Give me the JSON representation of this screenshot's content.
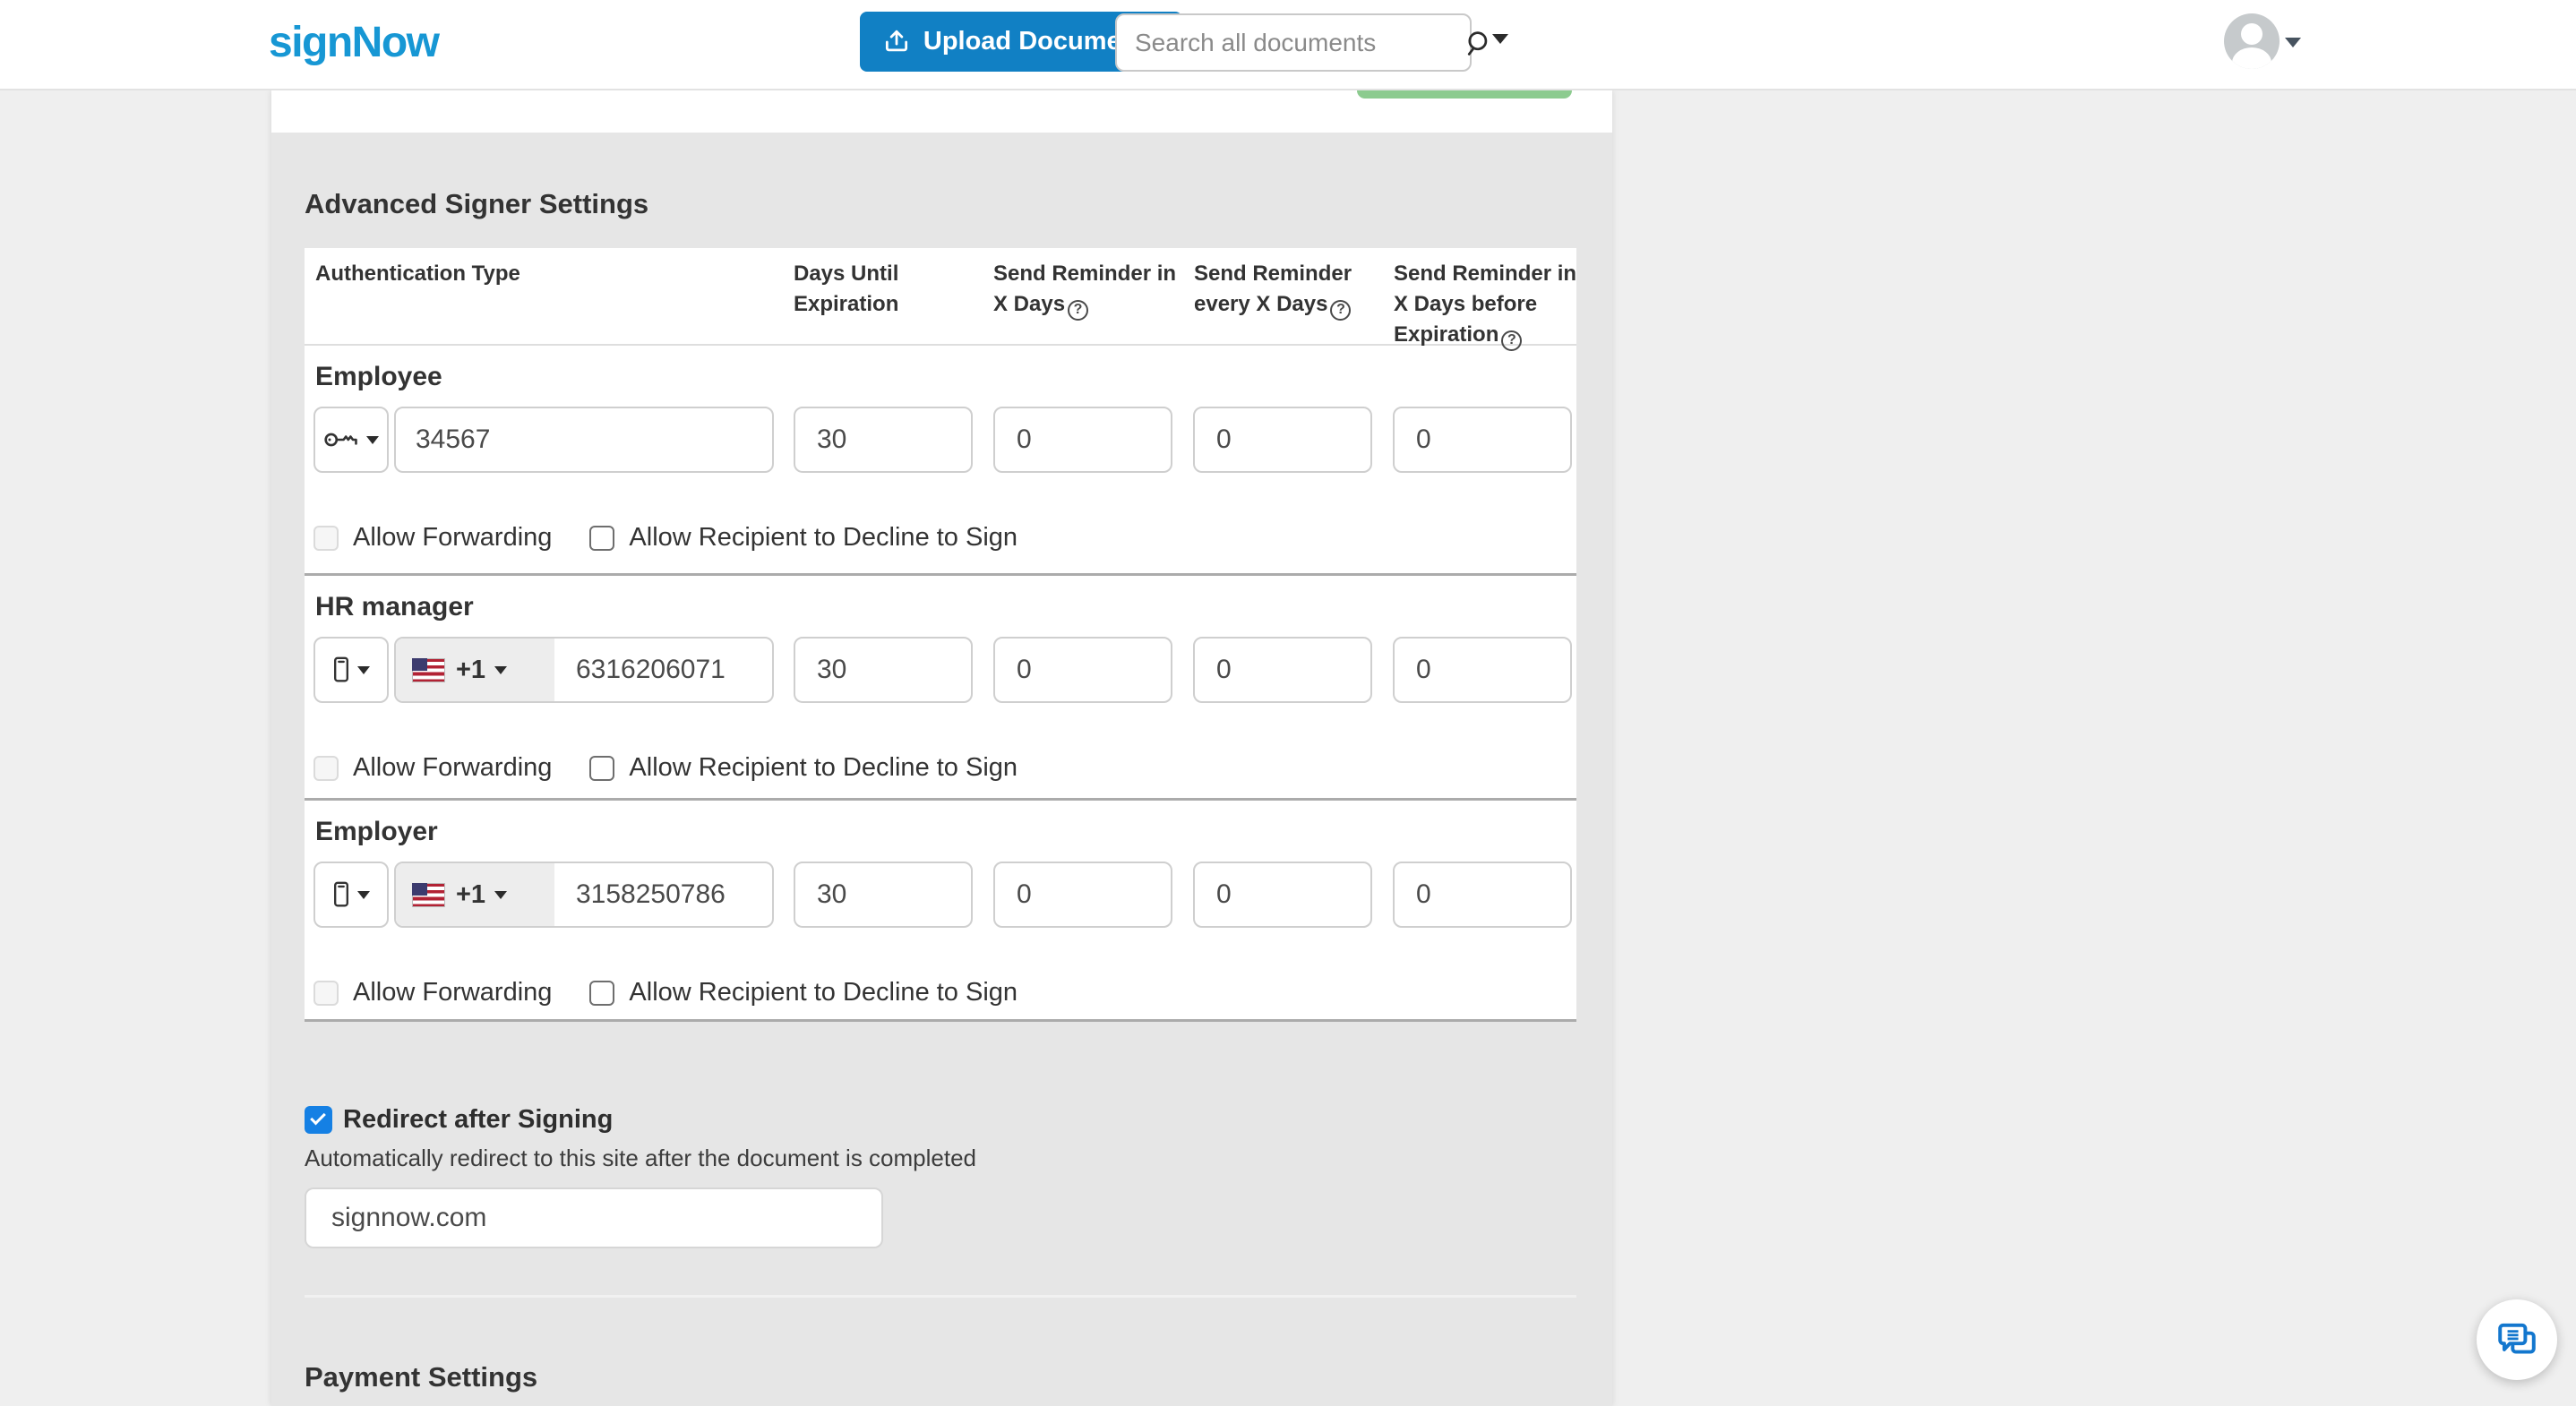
{
  "header": {
    "logo_text": "signNow",
    "upload_button_label": "Upload Documents",
    "search_placeholder": "Search all documents"
  },
  "advanced_settings": {
    "title": "Advanced Signer Settings",
    "table_headers": {
      "authentication_type": "Authentication Type",
      "days_until_expiration": "Days Until Expiration",
      "send_reminder_in_x_days": "Send Reminder in X Days",
      "send_reminder_every_x_days": "Send Reminder every X Days",
      "send_reminder_before_expiration": "Send Reminder in X Days before Expiration"
    },
    "signers": [
      {
        "name": "Employee",
        "auth_method": "password",
        "auth_value": "34567",
        "days_until_expiration": "30",
        "send_reminder_in": "0",
        "send_reminder_every": "0",
        "send_reminder_before": "0"
      },
      {
        "name": "HR manager",
        "auth_method": "phone-call",
        "country_code": "+1",
        "auth_value": "6316206071",
        "days_until_expiration": "30",
        "send_reminder_in": "0",
        "send_reminder_every": "0",
        "send_reminder_before": "0"
      },
      {
        "name": "Employer",
        "auth_method": "phone-call",
        "country_code": "+1",
        "auth_value": "3158250786",
        "days_until_expiration": "30",
        "send_reminder_in": "0",
        "send_reminder_every": "0",
        "send_reminder_before": "0"
      }
    ],
    "checkbox_labels": {
      "allow_forwarding": "Allow Forwarding",
      "allow_decline": "Allow Recipient to Decline to Sign"
    }
  },
  "redirect_section": {
    "label": "Redirect after Signing",
    "checked": true,
    "description": "Automatically redirect to this site after the document is completed",
    "url_value": "signnow.com"
  },
  "payment_section": {
    "title": "Payment Settings"
  },
  "icons": {
    "help": "?"
  },
  "colors": {
    "brand_blue": "#1797D4",
    "upload_button_blue": "#1180C4",
    "checked_checkbox_blue": "#1580E4",
    "save_button_green": "#8CCB8F",
    "panel_gray": "#E6E6E6",
    "page_background": "#EFEFEF"
  }
}
